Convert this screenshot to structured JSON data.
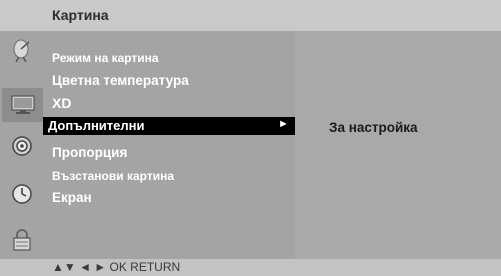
{
  "header": {
    "title": "Картина"
  },
  "sidebar": {
    "icons": [
      {
        "name": "satellite-dish-icon",
        "active": false
      },
      {
        "name": "monitor-icon",
        "active": true
      },
      {
        "name": "speaker-icon",
        "active": false
      },
      {
        "name": "clock-icon",
        "active": false
      },
      {
        "name": "lock-icon",
        "active": false
      }
    ]
  },
  "menu": {
    "items": [
      {
        "label": "Режим на картина"
      },
      {
        "label": "Цветна температура"
      },
      {
        "label": "XD"
      },
      {
        "label": "Допълнителни",
        "selected": true,
        "arrow": "►"
      },
      {
        "label": "Пропорция"
      },
      {
        "label": "Възстанови картина"
      },
      {
        "label": "Екран"
      }
    ]
  },
  "submenu": {
    "option": "За настройка"
  },
  "footer": {
    "hint": "▲▼  ◄ ►  OK  RETURN"
  },
  "colors": {
    "background": "#a4a4a4",
    "header": "#c9c9c9",
    "selected": "#000000",
    "text": "#ffffff"
  }
}
